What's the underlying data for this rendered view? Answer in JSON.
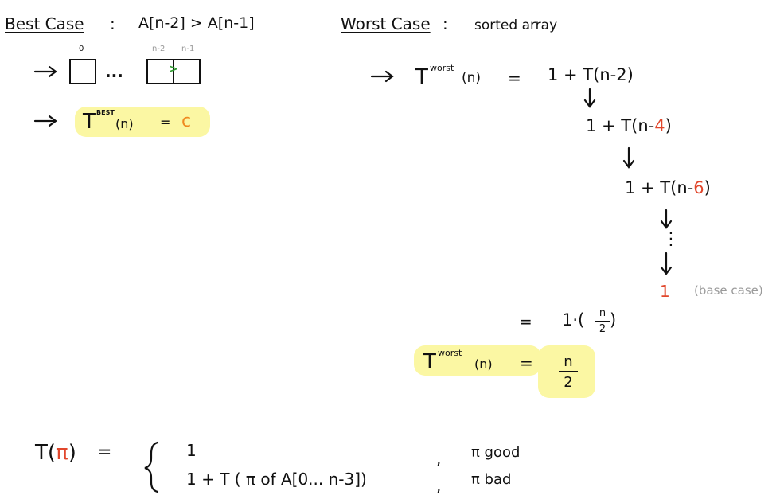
{
  "best_case": {
    "title": "Best Case",
    "colon": ":",
    "condition": "A[n-2] > A[n-1]",
    "index_0": "0",
    "index_n2": "n-2",
    "index_n1": "n-1",
    "ellipsis": "...",
    "compare": ">",
    "T": "T",
    "superscript": "BEST",
    "arg": "(n)",
    "equals": "=",
    "result": "c"
  },
  "worst_case": {
    "title": "Worst Case",
    "colon": ":",
    "description": "sorted array",
    "T": "T",
    "superscript": "worst",
    "arg": "(n)",
    "equals": "=",
    "step1": "1 + T(n-2)",
    "step2_prefix": "1 + T(n-",
    "step2_num": "4",
    "step2_suffix": ")",
    "step3_prefix": "1 + T(n-",
    "step3_num": "6",
    "step3_suffix": ")",
    "vdots": "⋮",
    "base_value": "1",
    "base_note": "(base case)",
    "equals2": "=",
    "expansion": "1·(",
    "expansion_num": "n",
    "expansion_den": "2",
    "expansion_close": ")",
    "final_T": "T",
    "final_sup": "worst",
    "final_arg": "(n)",
    "final_equals": "=",
    "final_num": "n",
    "final_den": "2"
  },
  "piecewise": {
    "lhs_prefix": "T(",
    "lhs_pi": "π",
    "lhs_suffix": ")",
    "equals": "=",
    "case1_value": "1",
    "case1_comma": ",",
    "case1_condition": "π good",
    "case2_value": "1 +  T ( π of  A[0... n-3])",
    "case2_comma": ",",
    "case2_condition": "π bad"
  },
  "colors": {
    "highlight": "#fbf7a3",
    "red_accent": "#e1472c",
    "orange_accent": "#ef8a20",
    "green_accent": "#2e9a2e",
    "gray_note": "#9a9a9a"
  }
}
